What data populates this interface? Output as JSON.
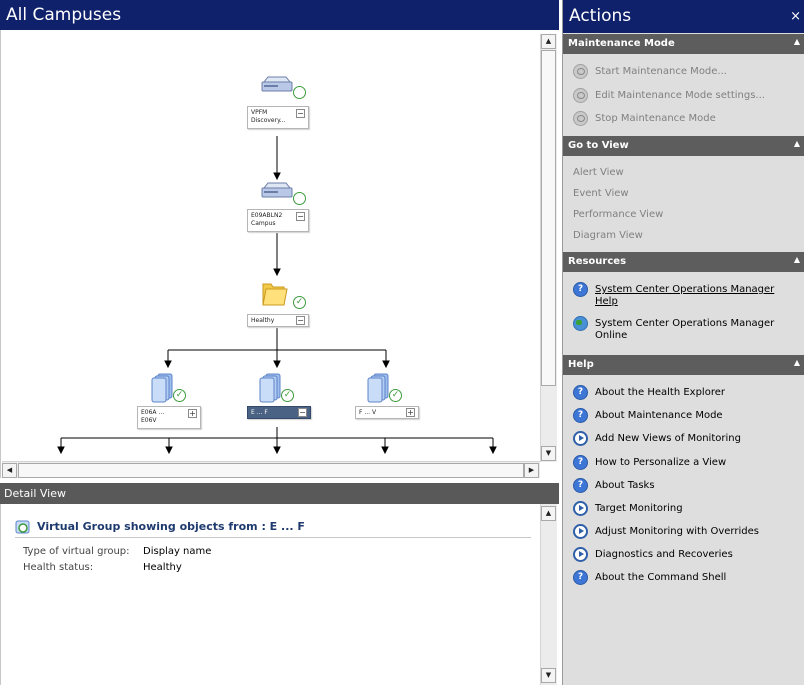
{
  "left": {
    "title": "All Campuses",
    "diagram": {
      "nodes": [
        {
          "id": "vpfm",
          "line1": "VPFM",
          "line2": "Discovery..."
        },
        {
          "id": "campus",
          "line1": "E09ABLN2",
          "line2": "Campus"
        },
        {
          "id": "healthy",
          "line1": "Healthy",
          "line2": ""
        },
        {
          "id": "child1",
          "line1": "E06A ...",
          "line2": "E06V"
        },
        {
          "id": "child2",
          "line1": "E ... F",
          "line2": ""
        },
        {
          "id": "child3",
          "line1": "F ... V",
          "line2": ""
        }
      ],
      "expand_collapse": "−",
      "expand_expand": "+"
    },
    "detail": {
      "header": "Detail View",
      "title": "Virtual Group showing objects from : E ... F",
      "props": [
        {
          "label": "Type of virtual group:",
          "value": "Display name"
        },
        {
          "label": "Health status:",
          "value": "Healthy"
        }
      ]
    }
  },
  "actions": {
    "title": "Actions",
    "close": "×",
    "sections": [
      {
        "title": "Maintenance Mode",
        "items": [
          {
            "label": "Start Maintenance Mode...",
            "icon": "maintenance-icon"
          },
          {
            "label": "Edit Maintenance Mode settings...",
            "icon": "maintenance-icon"
          },
          {
            "label": "Stop Maintenance Mode",
            "icon": "maintenance-icon"
          }
        ]
      },
      {
        "title": "Go to View",
        "items": [
          {
            "label": "Alert View"
          },
          {
            "label": "Event View"
          },
          {
            "label": "Performance View"
          },
          {
            "label": "Diagram View"
          }
        ]
      },
      {
        "title": "Resources",
        "items": [
          {
            "label": "System Center Operations Manager Help",
            "icon": "help-icon"
          },
          {
            "label": "System Center Operations Manager Online",
            "icon": "globe-icon"
          }
        ]
      },
      {
        "title": "Help",
        "items": [
          {
            "label": "About the Health Explorer",
            "icon": "help-icon"
          },
          {
            "label": "About Maintenance Mode",
            "icon": "help-icon"
          },
          {
            "label": "Add New Views of Monitoring",
            "icon": "play-icon"
          },
          {
            "label": "How to Personalize a View",
            "icon": "help-icon"
          },
          {
            "label": "About Tasks",
            "icon": "help-icon"
          },
          {
            "label": "Target Monitoring",
            "icon": "play-icon"
          },
          {
            "label": "Adjust Monitoring with Overrides",
            "icon": "play-icon"
          },
          {
            "label": "Diagnostics and Recoveries",
            "icon": "play-icon"
          },
          {
            "label": "About the Command Shell",
            "icon": "help-icon"
          }
        ]
      }
    ]
  },
  "colors": {
    "title_bar": "#10216b",
    "section_header": "#5d5d5d",
    "actions_bg": "#dedede",
    "healthy_green": "#3c9b3c",
    "selected_node": "#4a6284"
  }
}
